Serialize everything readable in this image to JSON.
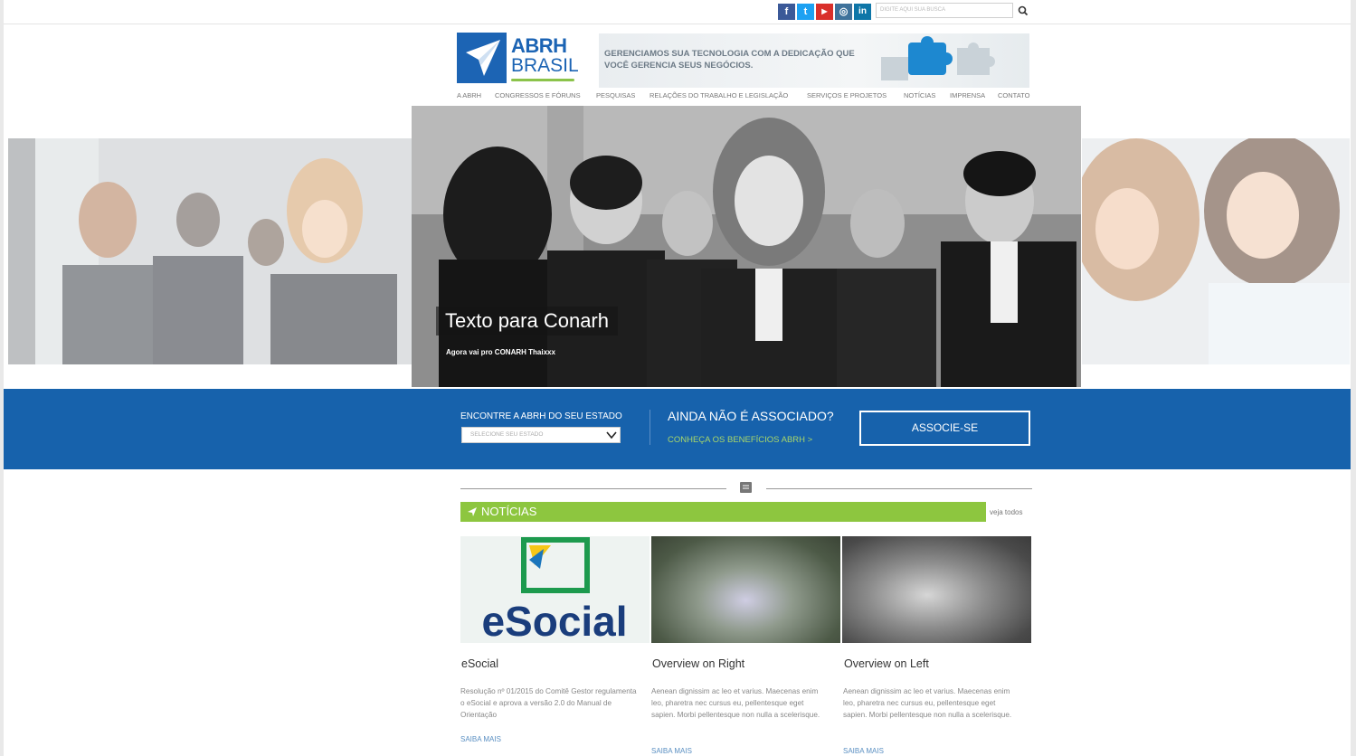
{
  "header": {
    "social": [
      {
        "name": "facebook",
        "glyph": "f",
        "color": "#3b5998"
      },
      {
        "name": "twitter",
        "glyph": "t",
        "color": "#1da1f2"
      },
      {
        "name": "youtube",
        "glyph": "▶",
        "color": "#d9302b"
      },
      {
        "name": "instagram",
        "glyph": "◎",
        "color": "#3f729b"
      },
      {
        "name": "linkedin",
        "glyph": "in",
        "color": "#0e76a8"
      }
    ],
    "search_placeholder": "DIGITE AQUI SUA BUSCA",
    "logo_line1": "ABRH",
    "logo_line2": "BRASIL",
    "ad_text": "GERENCIAMOS SUA TECNOLOGIA COM A DEDICAÇÃO QUE VOCÊ GERENCIA SEUS NEGÓCIOS."
  },
  "nav": [
    "A ABRH",
    "CONGRESSOS E FÓRUNS",
    "PESQUISAS",
    "RELAÇÕES DO TRABALHO E LEGISLAÇÃO",
    "SERVIÇOS E PROJETOS",
    "NOTÍCIAS",
    "IMPRENSA",
    "CONTATO"
  ],
  "slider": {
    "title": "Texto para Conarh",
    "subtitle": "Agora vai pro CONARH Thaixxx"
  },
  "band": {
    "state_label": "ENCONTRE A ABRH DO SEU ESTADO",
    "state_placeholder": "SELECIONE SEU ESTADO",
    "assoc_title": "AINDA NÃO É ASSOCIADO?",
    "assoc_link": "CONHEÇA OS BENEFÍCIOS ABRH >",
    "assoc_button": "ASSOCIE-SE"
  },
  "news": {
    "heading": "NOTÍCIAS",
    "see_all": "veja todos",
    "logo_text": "eSocial",
    "cards": [
      {
        "title": "eSocial",
        "text": "Resolução nº 01/2015 do Comitê Gestor regulamenta o eSocial e aprova a versão 2.0 do Manual de Orientação",
        "more": "SAIBA MAIS"
      },
      {
        "title": "Overview on Right",
        "text": "Aenean dignissim ac leo et varius. Maecenas enim leo, pharetra nec cursus eu, pellentesque eget sapien. Morbi pellentesque non nulla a scelerisque.",
        "more": "SAIBA MAIS"
      },
      {
        "title": "Overview on Left",
        "text": "Aenean dignissim ac leo et varius. Maecenas enim leo, pharetra nec cursus eu, pellentesque eget sapien. Morbi pellentesque non nulla a scelerisque.",
        "more": "SAIBA MAIS"
      }
    ]
  },
  "colors": {
    "brand_blue": "#1762ac",
    "news_green": "#8dc63f"
  }
}
